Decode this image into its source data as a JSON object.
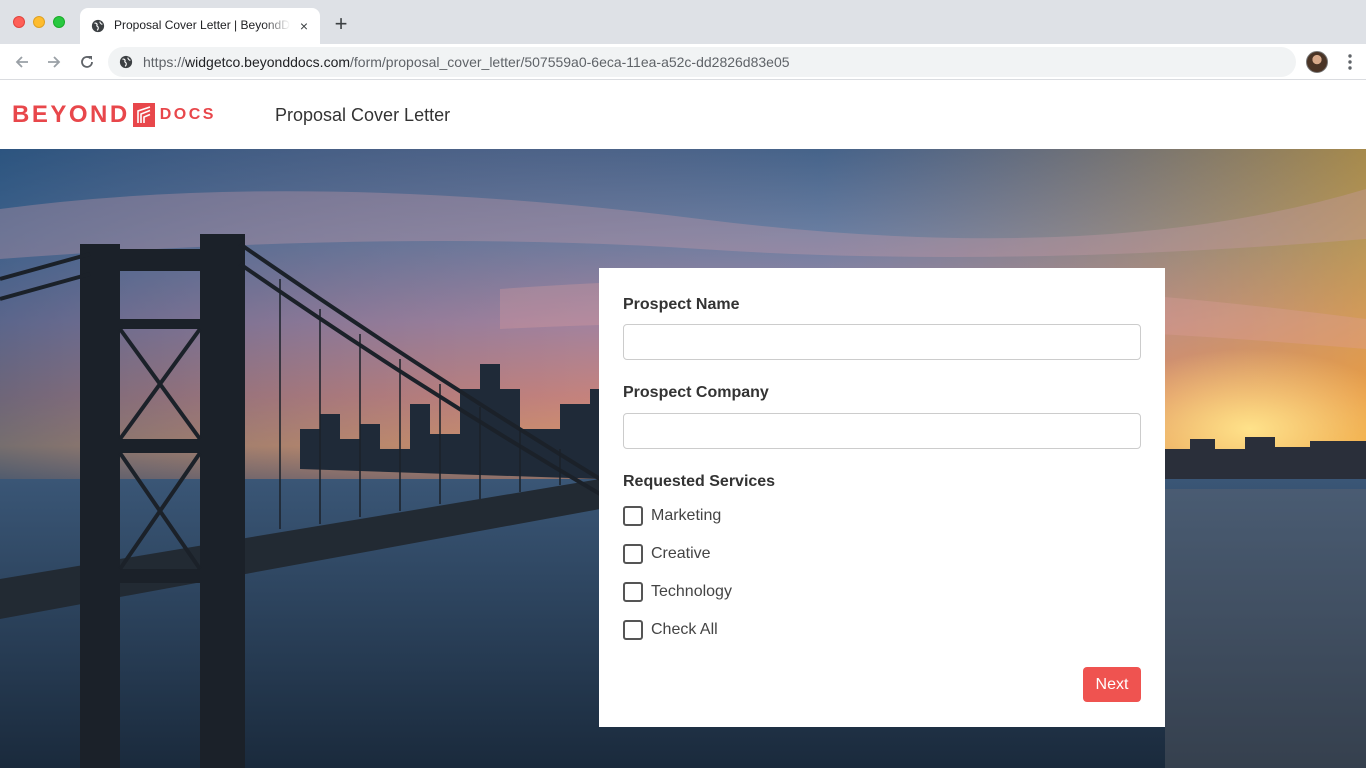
{
  "browser": {
    "tab_title": "Proposal Cover Letter | BeyondDocs",
    "tab_close": "×",
    "new_tab": "+",
    "url_prefix": "https://",
    "url_host": "widgetco.beyonddocs.com",
    "url_path": "/form/proposal_cover_letter/507559a0-6eca-11ea-a52c-dd2826d83e05"
  },
  "header": {
    "logo_beyond": "BEYOND",
    "logo_docs": "DOCS",
    "title": "Proposal Cover Letter"
  },
  "form": {
    "prospect_name_label": "Prospect Name",
    "prospect_name_value": "",
    "prospect_company_label": "Prospect Company",
    "prospect_company_value": "",
    "services_label": "Requested Services",
    "services": [
      {
        "label": "Marketing",
        "checked": false
      },
      {
        "label": "Creative",
        "checked": false
      },
      {
        "label": "Technology",
        "checked": false
      },
      {
        "label": "Check All",
        "checked": false
      }
    ],
    "next_label": "Next"
  },
  "colors": {
    "brand": "#e8474b",
    "button": "#ef5350"
  }
}
